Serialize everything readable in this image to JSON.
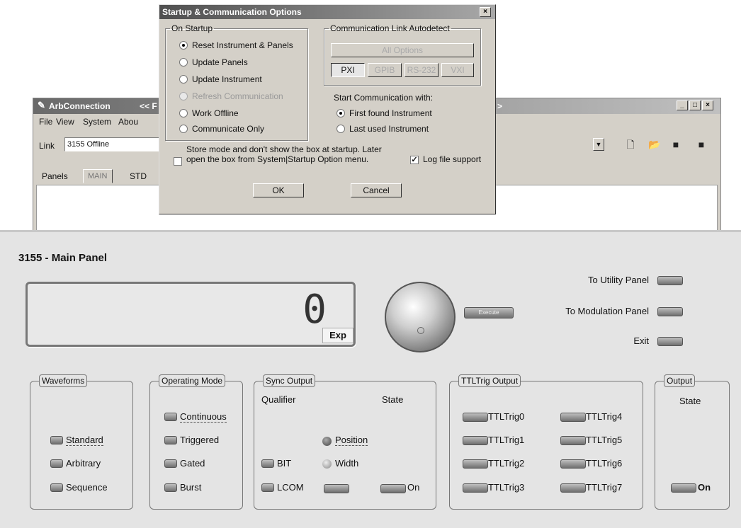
{
  "arb_window": {
    "title": "ArbConnection",
    "title_suffix": "<< F",
    "title_right": ">",
    "menu": [
      "File",
      "View",
      "System",
      "Abou"
    ],
    "link_label": "Link",
    "link_value": "3155 Offline",
    "tabs": [
      "Panels",
      "MAIN",
      "STD"
    ],
    "toolbar_icons": [
      "new-file-icon",
      "open-folder-icon",
      "save-icon",
      "save-all-icon"
    ]
  },
  "dialog": {
    "title": "Startup & Communication Options",
    "startup_group": {
      "legend": "On Startup",
      "options": [
        {
          "label": "Reset Instrument & Panels",
          "selected": true,
          "disabled": false
        },
        {
          "label": "Update Panels",
          "selected": false,
          "disabled": false
        },
        {
          "label": "Update Instrument",
          "selected": false,
          "disabled": false
        },
        {
          "label": "Refresh Communication",
          "selected": false,
          "disabled": true
        },
        {
          "label": "Work Offline",
          "selected": false,
          "disabled": false
        },
        {
          "label": "Communicate Only",
          "selected": false,
          "disabled": false
        }
      ]
    },
    "autodetect_group": {
      "legend": "Communication Link Autodetect",
      "all_button": "All Options",
      "link_buttons": [
        "PXI",
        "GPIB",
        "RS-232",
        "VXI"
      ]
    },
    "start_comm_label": "Start Communication with:",
    "start_comm_options": [
      {
        "label": "First found Instrument",
        "selected": true
      },
      {
        "label": "Last used Instrument",
        "selected": false
      }
    ],
    "store_mode_text": "Store mode and don't show the box at startup. Later open the box from System|Startup Option menu.",
    "store_mode_checked": false,
    "log_file_label": "Log file support",
    "log_file_checked": true,
    "ok_label": "OK",
    "cancel_label": "Cancel"
  },
  "main_panel": {
    "title": "3155 - Main Panel",
    "display_value": "0",
    "display_exp": "Exp",
    "execute_label": "Execute",
    "nav": [
      {
        "label": "To Utility Panel"
      },
      {
        "label": "To Modulation Panel"
      },
      {
        "label": "Exit"
      }
    ],
    "waveforms": {
      "title": "Waveforms",
      "items": [
        "Standard",
        "Arbitrary",
        "Sequence"
      ]
    },
    "operating_mode": {
      "title": "Operating Mode",
      "items": [
        "Continuous",
        "Triggered",
        "Gated",
        "Burst"
      ]
    },
    "sync_output": {
      "title": "Sync Output",
      "qualifier_label": "Qualifier",
      "state_label": "State",
      "position_label": "Position",
      "width_label": "Width",
      "bit_label": "BIT",
      "lcom_label": "LCOM",
      "on_label": "On"
    },
    "ttltrig_output": {
      "title": "TTLTrig Output",
      "left": [
        "TTLTrig0",
        "TTLTrig1",
        "TTLTrig2",
        "TTLTrig3"
      ],
      "right": [
        "TTLTrig4",
        "TTLTrig5",
        "TTLTrig6",
        "TTLTrig7"
      ]
    },
    "output": {
      "title": "Output",
      "state_label": "State",
      "on_label": "On"
    }
  }
}
